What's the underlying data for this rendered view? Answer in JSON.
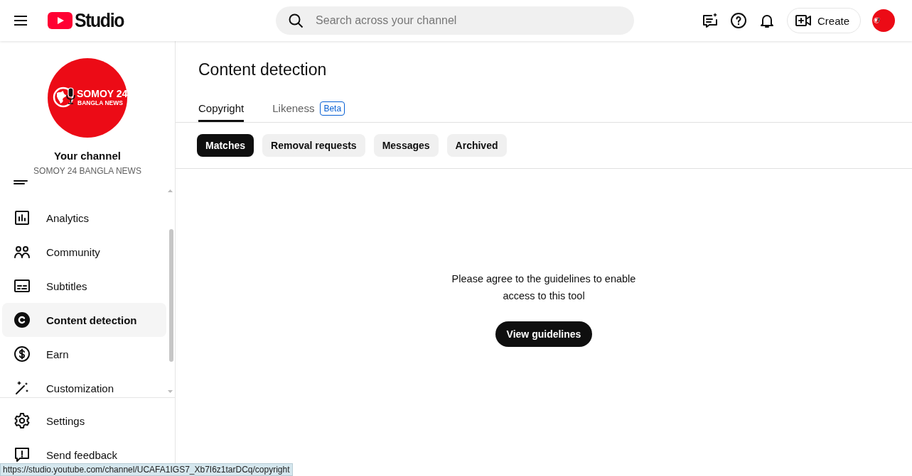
{
  "header": {
    "logo_text": "Studio",
    "search": {
      "placeholder": "Search across your channel"
    },
    "create_label": "Create"
  },
  "sidebar": {
    "avatar": {
      "line1": "SOMOY 24",
      "line2": "BANGLA NEWS"
    },
    "channel_title": "Your channel",
    "channel_name": "SOMOY 24 BANGLA NEWS",
    "items": [
      {
        "label": "Analytics",
        "selected": false
      },
      {
        "label": "Community",
        "selected": false
      },
      {
        "label": "Subtitles",
        "selected": false
      },
      {
        "label": "Content detection",
        "selected": true
      },
      {
        "label": "Earn",
        "selected": false
      },
      {
        "label": "Customization",
        "selected": false
      }
    ],
    "footer_items": [
      {
        "label": "Settings"
      },
      {
        "label": "Send feedback"
      }
    ]
  },
  "page": {
    "title": "Content detection",
    "tabs": [
      {
        "label": "Copyright",
        "selected": true
      },
      {
        "label": "Likeness",
        "badge": "Beta",
        "selected": false
      }
    ],
    "chips": [
      {
        "label": "Matches",
        "selected": true
      },
      {
        "label": "Removal requests",
        "selected": false
      },
      {
        "label": "Messages",
        "selected": false
      },
      {
        "label": "Archived",
        "selected": false
      }
    ],
    "message": "Please agree to the guidelines to enable access to this tool",
    "button": "View guidelines"
  },
  "status_bar": {
    "url": "https://studio.youtube.com/channel/UCAFA1IGS7_Xb7I6z1tarDCq/copyright"
  }
}
